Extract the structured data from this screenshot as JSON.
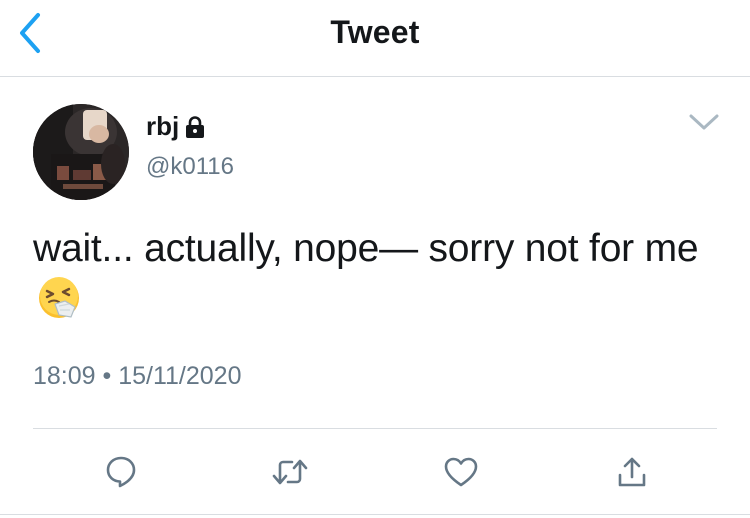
{
  "header": {
    "title": "Tweet",
    "back_icon": "chevron-left-icon"
  },
  "tweet": {
    "display_name": "rbj",
    "protected_icon": "lock-icon",
    "handle": "@k0116",
    "text": "wait... actually, nope— sorry not for me",
    "emoji_icon": "sneezing-face-emoji",
    "timestamp": "18:09 • 15/11/2020",
    "menu_icon": "chevron-down-icon"
  },
  "actions": [
    {
      "name": "reply",
      "icon": "reply-icon"
    },
    {
      "name": "retweet",
      "icon": "retweet-icon"
    },
    {
      "name": "like",
      "icon": "heart-icon"
    },
    {
      "name": "share",
      "icon": "share-icon"
    }
  ],
  "colors": {
    "accent": "#1da1f2",
    "text_primary": "#14171a",
    "text_secondary": "#657786",
    "divider": "#d9dde1"
  }
}
